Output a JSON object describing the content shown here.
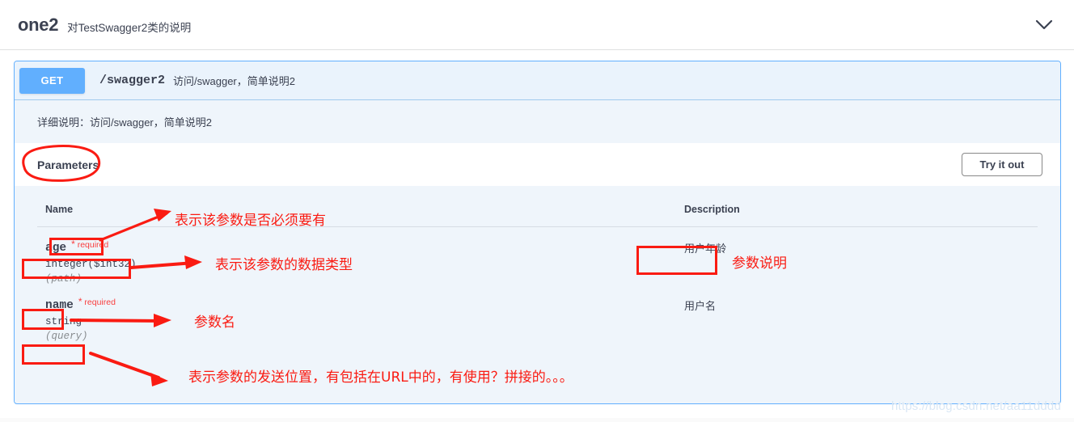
{
  "tag": {
    "name": "one2",
    "description": "对TestSwagger2类的说明",
    "collapse_icon": "chevron-down-icon"
  },
  "operation": {
    "method": "GET",
    "path": "/swagger2",
    "summary": "访问/swagger，简单说明2",
    "notes": "详细说明：访问/swagger，简单说明2"
  },
  "parameters_section": {
    "title": "Parameters",
    "try_it_out_label": "Try it out",
    "columns": [
      "Name",
      "Description"
    ],
    "rows": [
      {
        "name": "age",
        "required_label": "required",
        "required_star": "*",
        "type": "integer($int32)",
        "in": "(path)",
        "description": "用户年龄"
      },
      {
        "name": "name",
        "required_label": "required",
        "required_star": "*",
        "type": "string",
        "in": "(query)",
        "description": "用户名"
      }
    ]
  },
  "annotations": {
    "required_note": "表示该参数是否必须要有",
    "type_note": "表示该参数的数据类型",
    "name_note": "参数名",
    "in_note": "表示参数的发送位置，有包括在URL中的，有使用？拼接的。。。",
    "desc_note": "参数说明",
    "color": "#fa1b12"
  },
  "watermark": "https://blog.csdn.net/aa11dddd"
}
